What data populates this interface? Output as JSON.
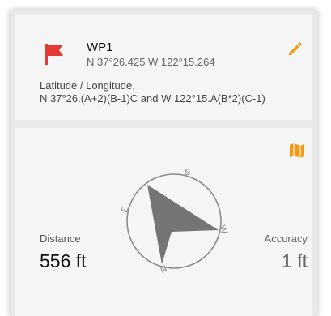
{
  "waypoint": {
    "name": "WP1",
    "coordinates": "N 37°26.425 W 122°15.264",
    "flag_icon": "flag-icon",
    "flag_color": "#e53935"
  },
  "formula": {
    "label": "Latitude / Longitude,",
    "value": "N 37°26.(A+2)(B-1)C and W 122°15.A(B*2)(C-1)"
  },
  "actions": {
    "edit_icon": "pencil-icon",
    "map_icon": "map-icon",
    "accent_color": "#f59a10"
  },
  "compass": {
    "labels": [
      "S",
      "E",
      "W",
      "N"
    ],
    "arrow_color": "#757575"
  },
  "distance": {
    "label": "Distance",
    "value": "556 ft"
  },
  "accuracy": {
    "label": "Accuracy",
    "value": "1 ft"
  }
}
